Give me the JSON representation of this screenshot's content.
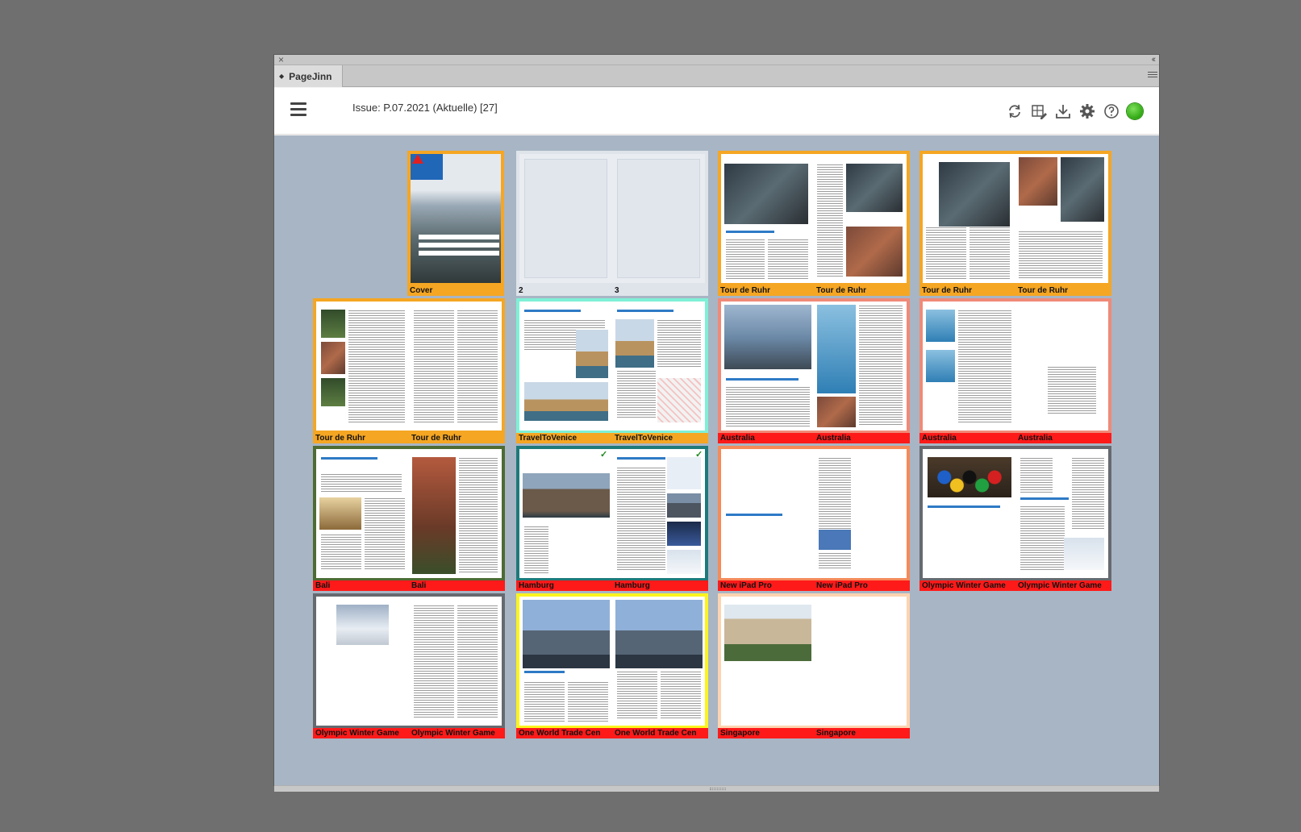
{
  "panel": {
    "close_glyph": "×",
    "collapse_glyph": "‹‹",
    "tab_label": "PageJinn",
    "tab_arrows": "⌃⌄",
    "issue_text": "Issue: P.07.2021 (Aktuelle) [27]",
    "toolbar_icons": [
      "refresh-icon",
      "layout-edit-icon",
      "download-icon",
      "settings-icon",
      "help-icon",
      "status-indicator"
    ],
    "status_color": "#2fa712"
  },
  "spreads": [
    {
      "id": "s1",
      "type": "single",
      "color": "#f5a623",
      "labels": [
        "Cover"
      ],
      "style": "cover"
    },
    {
      "id": "s2",
      "type": "double",
      "color": "#dfe3ea",
      "labels": [
        "2",
        "3"
      ],
      "style": "blank"
    },
    {
      "id": "s3",
      "type": "double",
      "color": "#f5a623",
      "labels": [
        "Tour de Ruhr",
        "Tour de Ruhr"
      ],
      "style": "ruhr1"
    },
    {
      "id": "s4",
      "type": "double",
      "color": "#f5a623",
      "labels": [
        "Tour de Ruhr",
        "Tour de Ruhr"
      ],
      "style": "ruhr2"
    },
    {
      "id": "s5",
      "type": "double",
      "color": "#f5a623",
      "labels": [
        "Tour de Ruhr",
        "Tour de Ruhr"
      ],
      "style": "ruhr3"
    },
    {
      "id": "s6",
      "type": "double",
      "color": "#7ff0d6",
      "labels": [
        "TravelToVenice",
        "TravelToVenice"
      ],
      "style": "venice"
    },
    {
      "id": "s7",
      "type": "double",
      "color": "#f08a78",
      "labels": [
        "Australia",
        "Australia"
      ],
      "style": "australia1"
    },
    {
      "id": "s8",
      "type": "double",
      "color": "#f08a78",
      "labels": [
        "Australia",
        "Australia"
      ],
      "style": "australia2"
    },
    {
      "id": "s9",
      "type": "double",
      "color": "#4e6b34",
      "labels": [
        "Bali",
        "Bali"
      ],
      "style": "bali"
    },
    {
      "id": "s10",
      "type": "double",
      "color": "#1e7a7a",
      "labels": [
        "Hamburg",
        "Hamburg"
      ],
      "style": "hamburg"
    },
    {
      "id": "s11",
      "type": "double",
      "color": "#f58a5a",
      "labels": [
        "New iPad Pro",
        "New iPad Pro"
      ],
      "style": "ipad"
    },
    {
      "id": "s12",
      "type": "double",
      "color": "#666a70",
      "labels": [
        "Olympic Winter Game",
        "Olympic Winter Game"
      ],
      "style": "olympic1"
    },
    {
      "id": "s13",
      "type": "double",
      "color": "#666a70",
      "labels": [
        "Olympic Winter Game",
        "Olympic Winter Game"
      ],
      "style": "olympic2"
    },
    {
      "id": "s14",
      "type": "double",
      "color": "#fbf41e",
      "labels": [
        "One World Trade Cen",
        "One World Trade Cen"
      ],
      "style": "wtc"
    },
    {
      "id": "s15",
      "type": "double",
      "color": "#fcd4b0",
      "labels": [
        "Singapore",
        "Singapore"
      ],
      "style": "singapore"
    }
  ],
  "label_bar_colors": {
    "orange": "#f5a623",
    "red": "#ff1a1a",
    "mint": "#7ff0d6",
    "gray": "#dfe3ea"
  },
  "hamburg_check_glyph": "✓"
}
